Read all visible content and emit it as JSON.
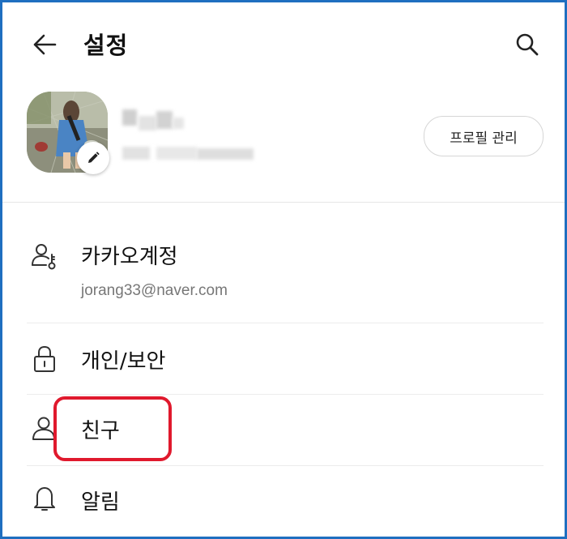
{
  "header": {
    "back_icon": "arrow-left-icon",
    "title": "설정",
    "search_icon": "search-icon"
  },
  "profile": {
    "edit_icon": "pencil-icon",
    "manage_button": "프로필 관리"
  },
  "menu": {
    "items": [
      {
        "icon": "user-key-icon",
        "label": "카카오계정",
        "sub": "jorang33@naver.com"
      },
      {
        "icon": "lock-icon",
        "label": "개인/보안"
      },
      {
        "icon": "person-icon",
        "label": "친구"
      },
      {
        "icon": "bell-icon",
        "label": "알림"
      }
    ]
  },
  "colors": {
    "frame_border": "#1f6fc0",
    "highlight": "#e0192d"
  }
}
